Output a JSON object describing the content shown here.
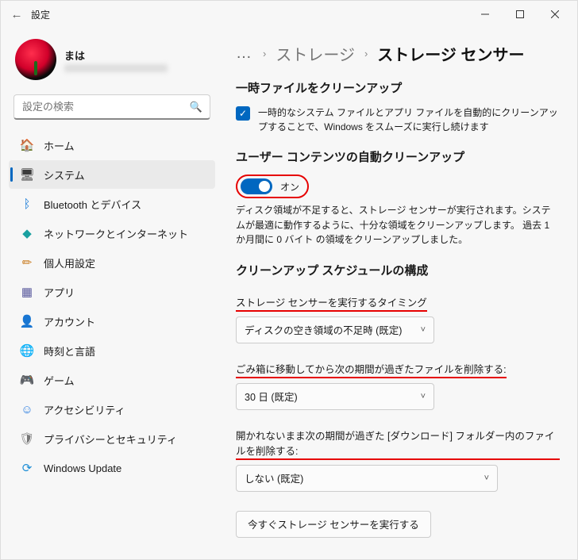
{
  "window": {
    "title": "設定"
  },
  "profile": {
    "name": "まは"
  },
  "search": {
    "placeholder": "設定の検索"
  },
  "sidebar": {
    "items": [
      {
        "label": "ホーム",
        "icon": "🏠"
      },
      {
        "label": "システム",
        "icon": "🖥"
      },
      {
        "label": "Bluetooth とデバイス",
        "icon": "ᛒ"
      },
      {
        "label": "ネットワークとインターネット",
        "icon": "◆"
      },
      {
        "label": "個人用設定",
        "icon": "✏"
      },
      {
        "label": "アプリ",
        "icon": "▦"
      },
      {
        "label": "アカウント",
        "icon": "👤"
      },
      {
        "label": "時刻と言語",
        "icon": "🌐"
      },
      {
        "label": "ゲーム",
        "icon": "🎮"
      },
      {
        "label": "アクセシビリティ",
        "icon": "☺"
      },
      {
        "label": "プライバシーとセキュリティ",
        "icon": "🛡"
      },
      {
        "label": "Windows Update",
        "icon": "⟳"
      }
    ]
  },
  "breadcrumb": {
    "dots": "…",
    "crumb1": "ストレージ",
    "current": "ストレージ センサー",
    "sep": "›"
  },
  "section1": {
    "title": "一時ファイルをクリーンアップ",
    "checkbox_desc": "一時的なシステム ファイルとアプリ ファイルを自動的にクリーンアップすることで、Windows をスムーズに実行し続けます"
  },
  "section2": {
    "title": "ユーザー コンテンツの自動クリーンアップ",
    "toggle_label": "オン",
    "para": "ディスク領域が不足すると、ストレージ センサーが実行されます。システムが最適に動作するように、十分な領域をクリーンアップします。 過去 1 か月間に 0 バイト の領域をクリーンアップしました。"
  },
  "section3": {
    "title": "クリーンアップ スケジュールの構成",
    "label_timing": "ストレージ センサーを実行するタイミング",
    "value_timing": "ディスクの空き領域の不足時 (既定)",
    "label_recycle": "ごみ箱に移動してから次の期間が過ぎたファイルを削除する:",
    "value_recycle": "30 日 (既定)",
    "label_downloads": "開かれないまま次の期間が過ぎた [ダウンロード] フォルダー内のファイルを削除する:",
    "value_downloads": "しない (既定)",
    "run_now": "今すぐストレージ センサーを実行する"
  }
}
